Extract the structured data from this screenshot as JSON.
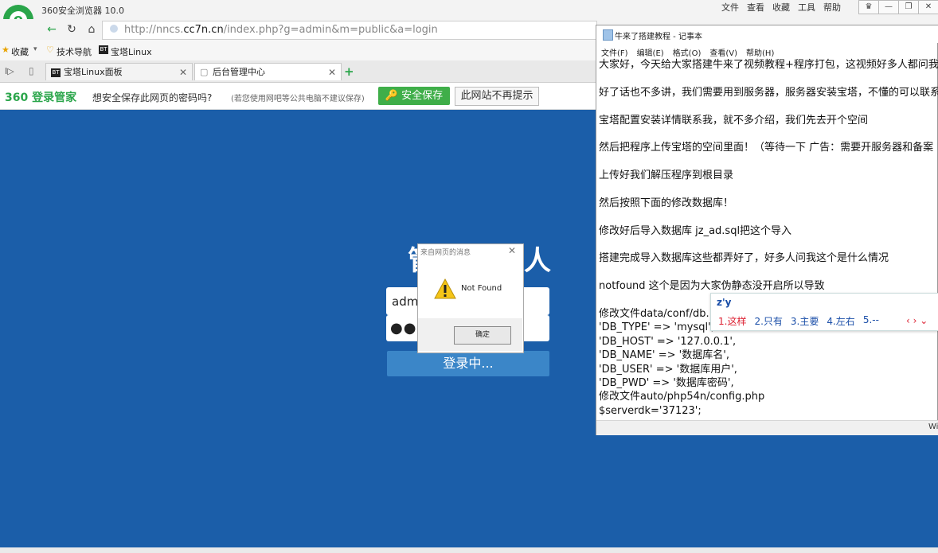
{
  "browser": {
    "title": "360安全浏览器 10.0",
    "menu": [
      "文件",
      "查看",
      "收藏",
      "工具",
      "帮助"
    ],
    "url_prefix": "http://nncs.",
    "url_host": "cc7n.cn",
    "url_path": "/index.php?g=admin&m=public&a=login",
    "bookmarks": [
      "收藏",
      "技术导航",
      "宝塔Linux"
    ],
    "tabs": [
      {
        "label": "宝塔Linux面板",
        "active": false
      },
      {
        "label": "后台管理中心",
        "active": true
      }
    ],
    "password_bar": {
      "brand": "360 登录管家",
      "question": "想安全保存此网页的密码吗?",
      "hint": "(若您使用网吧等公共电脑不建议保存)",
      "save_label": "安全保存",
      "never_label": "此网站不再提示"
    }
  },
  "page": {
    "background_color": "#1b5ea9",
    "heading_left": "管",
    "heading_right": "人",
    "username_value": "admi",
    "password_value": "●●●●",
    "login_button": "登录中..."
  },
  "alert": {
    "title": "来自网页的消息",
    "close": "✕",
    "message": "Not Found",
    "ok": "确定"
  },
  "notepad": {
    "title": "牛来了搭建教程 - 记事本",
    "menu": [
      "文件(F)",
      "编辑(E)",
      "格式(O)",
      "查看(V)",
      "帮助(H)"
    ],
    "lines": [
      "大家好，今天给大家搭建牛来了视频教程+程序打包，这视频好多人都问我",
      "",
      "好了话也不多讲，我们需要用到服务器，服务器安装宝塔，不懂的可以联系",
      "",
      "宝塔配置安装详情联系我，就不多介绍，我们先去开个空间",
      "",
      "然后把程序上传宝塔的空间里面！（等待一下 广告：需要开服务器和备案",
      "",
      "上传好我们解压程序到根目录",
      "",
      "然后按照下面的修改数据库！",
      "",
      "修改好后导入数据库 jz_ad.sql把这个导入",
      "",
      "搭建完成导入数据库这些都弄好了，好多人问我这个是什么情况",
      "",
      "notfound  这个是因为大家伪静态没开启所以导致",
      "",
      "修改文件data/conf/db.",
      "'DB_TYPE' => 'mysql',",
      "'DB_HOST' => '127.0.0.1',",
      "'DB_NAME' => '数据库名',",
      "'DB_USER' => '数据库用户',",
      "'DB_PWD' => '数据库密码',",
      "修改文件auto/php54n/config.php",
      "$serverdk='37123';"
    ],
    "status_right": "Wi"
  },
  "ime": {
    "input": "z'y",
    "candidates": [
      "1.这样",
      "2.只有",
      "3.主要",
      "4.左右",
      "5.--"
    ],
    "nav": "‹ › ⌄"
  }
}
